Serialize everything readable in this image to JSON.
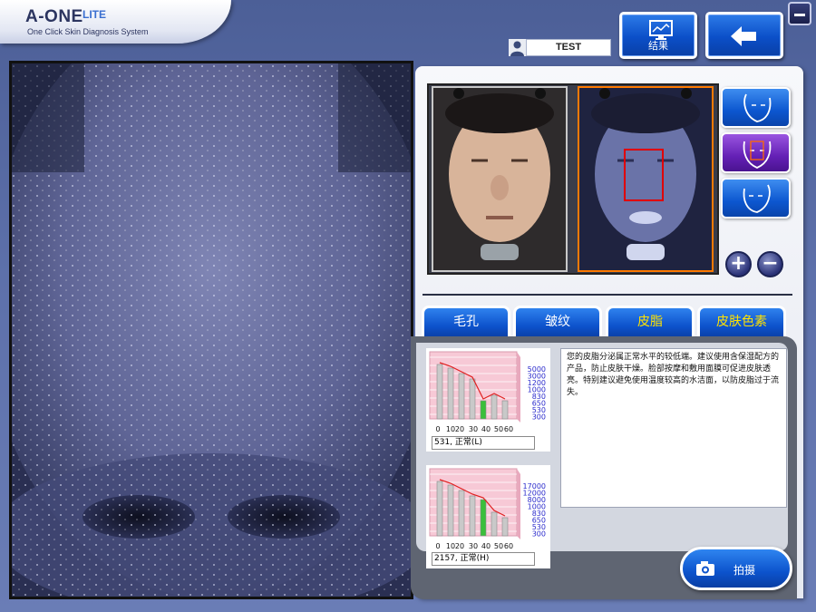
{
  "app": {
    "title": "A-ONE",
    "edition": "LITE",
    "subtitle": "One Click Skin Diagnosis System"
  },
  "user": {
    "name": "TEST"
  },
  "toolbar": {
    "result_label": "结果",
    "back_icon": "arrow-left-icon",
    "minimize_icon": "minimize-icon"
  },
  "tabs": [
    {
      "label": "毛孔",
      "color": "#ffffff"
    },
    {
      "label": "皱纹",
      "color": "#ffffff"
    },
    {
      "label": "皮脂",
      "color": "#ffe200"
    },
    {
      "label": "皮肤色素",
      "color": "#ffe200"
    }
  ],
  "charts": [
    {
      "scale_labels": [
        "5000",
        "3000",
        "1200",
        "1000",
        "830",
        "650",
        "530",
        "300"
      ],
      "x_labels": [
        "0",
        "10",
        "20",
        "30",
        "40",
        "50",
        "60"
      ],
      "value_text": "531, 正常(L)"
    },
    {
      "scale_labels": [
        "17000",
        "12000",
        "8000",
        "1000",
        "830",
        "650",
        "530",
        "300"
      ],
      "x_labels": [
        "0",
        "10",
        "20",
        "30",
        "40",
        "50",
        "60"
      ],
      "value_text": "2157, 正常(H)"
    }
  ],
  "advice": {
    "text": "您的皮脂分泌属正常水平的较低端。建议使用含保湿配方的产品，防止皮肤干燥。脸部按摩和敷用面膜可促进皮肤透亮。特别建议避免使用温度较高的水洁面，以防皮脂过于流失。"
  },
  "capture": {
    "label": "拍摄"
  },
  "colors": {
    "accent_blue": "#0d52cc",
    "active_purple": "#6420b5",
    "highlight_orange": "#ff7a00",
    "tab_highlight_yellow": "#ffe200",
    "focus_box_red": "#e00000"
  }
}
